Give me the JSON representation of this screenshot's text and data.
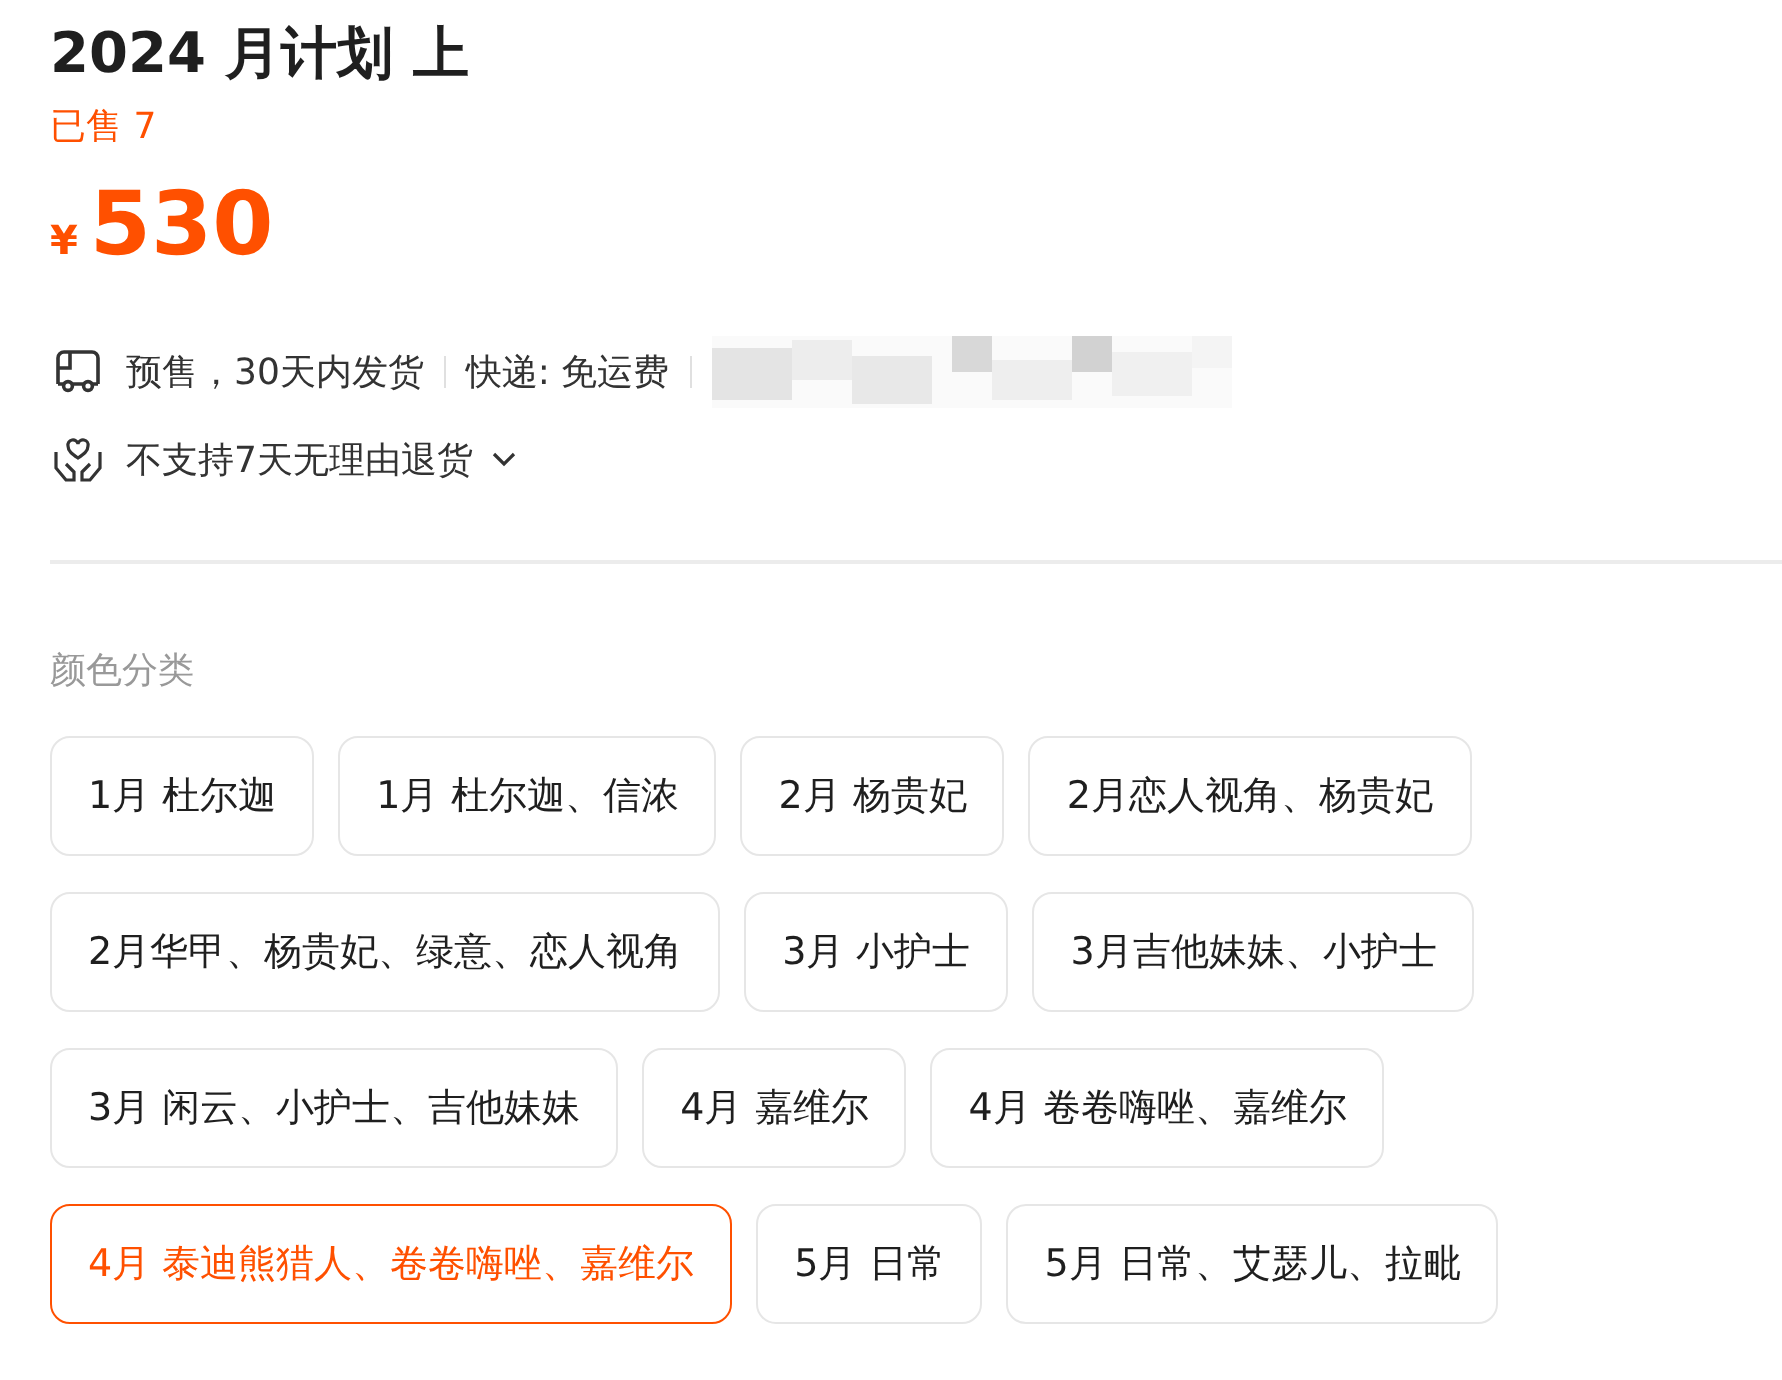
{
  "product": {
    "title": "2024 月计划 上",
    "sold": "已售 7",
    "currency": "¥",
    "price": "530"
  },
  "delivery": {
    "presale": "预售，30天内发货",
    "shipping": "快递: 免运费"
  },
  "returns": {
    "text": "不支持7天无理由退货",
    "expanded": false
  },
  "options": {
    "label": "颜色分类",
    "items": [
      {
        "label": "1月 杜尔迦",
        "selected": false
      },
      {
        "label": "1月 杜尔迦、信浓",
        "selected": false
      },
      {
        "label": "2月 杨贵妃",
        "selected": false
      },
      {
        "label": "2月恋人视角、杨贵妃",
        "selected": false
      },
      {
        "label": "2月华甲、杨贵妃、绿意、恋人视角",
        "selected": false
      },
      {
        "label": "3月 小护士",
        "selected": false
      },
      {
        "label": "3月吉他妹妹、小护士",
        "selected": false
      },
      {
        "label": "3月 闲云、小护士、吉他妹妹",
        "selected": false
      },
      {
        "label": "4月 嘉维尔",
        "selected": false
      },
      {
        "label": "4月 卷卷嗨唑、嘉维尔",
        "selected": false
      },
      {
        "label": "4月 泰迪熊猎人、卷卷嗨唑、嘉维尔",
        "selected": true
      },
      {
        "label": "5月 日常",
        "selected": false
      },
      {
        "label": "5月 日常、艾瑟儿、拉毗",
        "selected": false
      }
    ]
  }
}
